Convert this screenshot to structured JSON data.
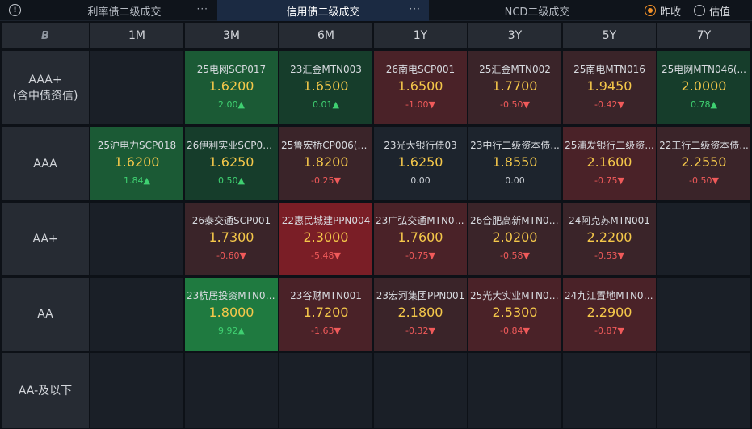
{
  "tabs": [
    {
      "label": "利率债二级成交",
      "more": "···",
      "active": false
    },
    {
      "label": "信用债二级成交",
      "more": "···",
      "active": true
    },
    {
      "label": "NCD二级成交",
      "more": "",
      "active": false
    }
  ],
  "radio": [
    {
      "label": "昨收",
      "selected": true
    },
    {
      "label": "估值",
      "selected": false
    }
  ],
  "corner": {
    "logo_text": "B"
  },
  "columns": [
    "1M",
    "3M",
    "6M",
    "1Y",
    "3Y",
    "5Y",
    "7Y"
  ],
  "rows": [
    {
      "label_lines": [
        "AAA+",
        "(含中债资信)"
      ],
      "cells": [
        null,
        {
          "name": "25电网SCP017",
          "rate": "1.6200",
          "change": "2.00▲",
          "dir": "up"
        },
        {
          "name": "23汇金MTN003",
          "rate": "1.6500",
          "change": "0.01▲",
          "dir": "up"
        },
        {
          "name": "26南电SCP001",
          "rate": "1.6500",
          "change": "-1.00▼",
          "dir": "down"
        },
        {
          "name": "25汇金MTN002",
          "rate": "1.7700",
          "change": "-0.50▼",
          "dir": "down"
        },
        {
          "name": "25南电MTN016",
          "rate": "1.9450",
          "change": "-0.42▼",
          "dir": "down"
        },
        {
          "name": "25电网MTN046(...",
          "rate": "2.0000",
          "change": "0.78▲",
          "dir": "up"
        }
      ]
    },
    {
      "label_lines": [
        "AAA"
      ],
      "cells": [
        {
          "name": "25沪电力SCP018",
          "rate": "1.6200",
          "change": "1.84▲",
          "dir": "up"
        },
        {
          "name": "26伊利实业SCP00...",
          "rate": "1.6250",
          "change": "0.50▲",
          "dir": "up"
        },
        {
          "name": "25鲁宏桥CP006(科...",
          "rate": "1.8200",
          "change": "-0.25▼",
          "dir": "down"
        },
        {
          "name": "23光大银行债03",
          "rate": "1.6250",
          "change": "0.00",
          "dir": "flat"
        },
        {
          "name": "23中行二级资本债...",
          "rate": "1.8550",
          "change": "0.00",
          "dir": "flat"
        },
        {
          "name": "25浦发银行二级资...",
          "rate": "2.1600",
          "change": "-0.75▼",
          "dir": "down"
        },
        {
          "name": "22工行二级资本债...",
          "rate": "2.2550",
          "change": "-0.50▼",
          "dir": "down"
        }
      ]
    },
    {
      "label_lines": [
        "AA+"
      ],
      "cells": [
        null,
        {
          "name": "26泰交通SCP001",
          "rate": "1.7300",
          "change": "-0.60▼",
          "dir": "down"
        },
        {
          "name": "22惠民城建PPN004",
          "rate": "2.3000",
          "change": "-5.48▼",
          "dir": "down"
        },
        {
          "name": "23广弘交通MTN001",
          "rate": "1.7600",
          "change": "-0.75▼",
          "dir": "down"
        },
        {
          "name": "26合肥高新MTN001",
          "rate": "2.0200",
          "change": "-0.58▼",
          "dir": "down"
        },
        {
          "name": "24阿克苏MTN001",
          "rate": "2.2200",
          "change": "-0.53▼",
          "dir": "down"
        },
        null
      ]
    },
    {
      "label_lines": [
        "AA"
      ],
      "cells": [
        null,
        {
          "name": "23杭居投资MTN001",
          "rate": "1.8000",
          "change": "9.92▲",
          "dir": "up"
        },
        {
          "name": "23谷财MTN001",
          "rate": "1.7200",
          "change": "-1.63▼",
          "dir": "down"
        },
        {
          "name": "23宏河集团PPN001",
          "rate": "2.1800",
          "change": "-0.32▼",
          "dir": "down"
        },
        {
          "name": "25光大实业MTN001",
          "rate": "2.5300",
          "change": "-0.84▼",
          "dir": "down"
        },
        {
          "name": "24九江置地MTN001",
          "rate": "2.2900",
          "change": "-0.87▼",
          "dir": "down"
        },
        null
      ]
    },
    {
      "label_lines": [
        "AA-及以下"
      ],
      "cells": [
        null,
        null,
        null,
        null,
        null,
        null,
        null
      ]
    }
  ],
  "colors": {
    "up_light": "#163d2b",
    "up_mid": "#1b5a35",
    "up_strong": "#1f7a40",
    "down_light": "#3a2429",
    "down_mid": "#4a2228",
    "down_strong": "#7a1e26",
    "flat": "#1d242d",
    "empty": "#1a1f27",
    "rate": "#f5c84a",
    "up_text": "#3fd071",
    "down_text": "#f05a5a"
  }
}
